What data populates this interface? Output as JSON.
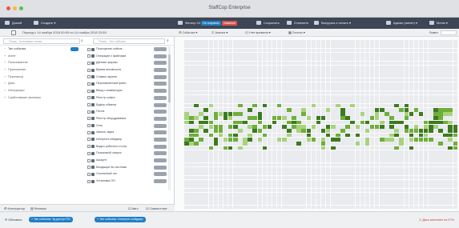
{
  "window": {
    "title": "StaffCop Enterprise"
  },
  "toolbar": {
    "home": "Домой",
    "create": "Создать",
    "filter": "Фильтр 24",
    "not_saved": "Не сохранен",
    "changed": "Изменен",
    "save": "Сохранить",
    "reports": "Отменить",
    "export": "Выгрузка и печать",
    "admin": "Админ (admin)",
    "menu": "Меню"
  },
  "period": {
    "text": "Период с 14 ноября 2018 00:00 по 14 ноября 2018 23:59"
  },
  "left_search": {
    "placeholder": "Поиск - Ключевые слова"
  },
  "filter_search": {
    "placeholder": "Поиск - Тип события"
  },
  "tree": {
    "items": [
      {
        "label": "Тип события"
      },
      {
        "label": "Агент"
      },
      {
        "label": "Пользователь"
      },
      {
        "label": "Приложение"
      },
      {
        "label": "Переписка"
      },
      {
        "label": "Дата"
      },
      {
        "label": "Инструкции"
      },
      {
        "label": "Сработавшие фильтры"
      }
    ]
  },
  "filters": {
    "items": [
      {
        "label": "Посещение сайтов"
      },
      {
        "label": "Операции с файлами"
      },
      {
        "label": "Данные формы"
      },
      {
        "label": "Время активности"
      },
      {
        "label": "Снимок экрана"
      },
      {
        "label": "Перехваченный файл"
      },
      {
        "label": "Ввод с клавиатуры"
      },
      {
        "label": "Реестр софта"
      },
      {
        "label": "Буфер обмена"
      },
      {
        "label": "Почта"
      },
      {
        "label": "Реестр оборудования"
      },
      {
        "label": "Сеть"
      },
      {
        "label": "Запись звука"
      },
      {
        "label": "Интернет-пейджер"
      },
      {
        "label": "Видео рабочего стола"
      },
      {
        "label": "Поисковый запрос"
      },
      {
        "label": "Аккаунт"
      },
      {
        "label": "Входящие во системы"
      },
      {
        "label": "Системный лог"
      },
      {
        "label": "Установка ПО"
      }
    ]
  },
  "left_footer": {
    "constructor": "Конструктор",
    "filters": "Фильтры",
    "auto": "Авто",
    "simultaneous": "Совместные"
  },
  "subbar": {
    "events": "События",
    "analysis": "Анализ",
    "time_account": "Учет времени",
    "reports": "Отчеты",
    "layout": "Лимит"
  },
  "statusbar": {
    "refresh": "Обновить",
    "chip1": "+ Тип события: Уд.доступ ПО",
    "chip2": "+ Тип события: Интернет-пейджер",
    "warning": "Диск заполнен на 97%"
  },
  "colors": {
    "accent_blue": "#2f6fb5",
    "cell_dark": "#3d7a1f",
    "cell_mid": "#6fae3b",
    "cell_light": "#a8d27c",
    "cell_dim": "#e9ebee",
    "badge_blue": "#1f7fc8",
    "badge_red": "#d9534f",
    "warning_red": "#c93b3b"
  }
}
